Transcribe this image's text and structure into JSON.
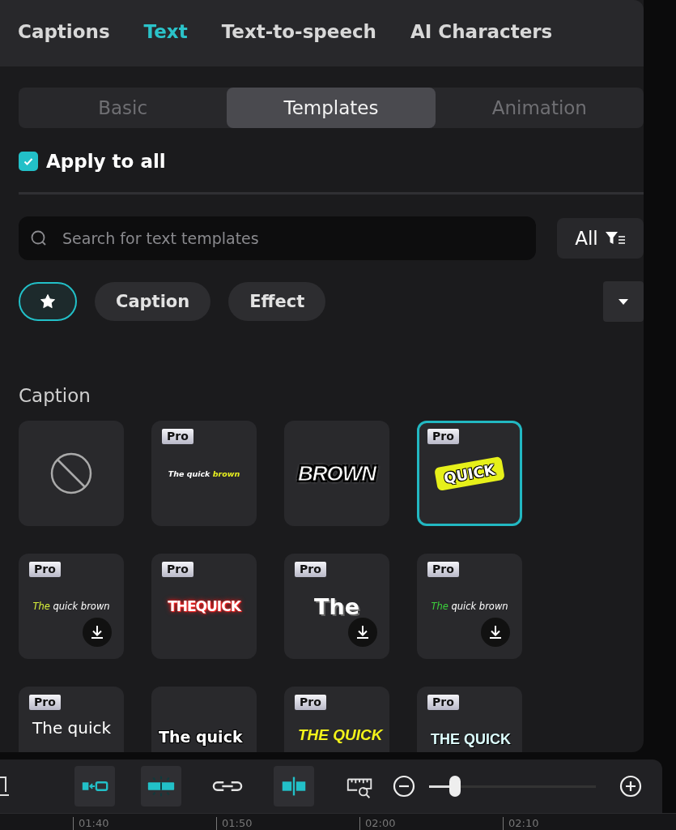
{
  "top_tabs": [
    {
      "label": "Captions",
      "selected": false
    },
    {
      "label": "Text",
      "selected": true
    },
    {
      "label": "Text-to-speech",
      "selected": false
    },
    {
      "label": "AI Characters",
      "selected": false
    }
  ],
  "sub_tabs": [
    {
      "label": "Basic",
      "selected": false
    },
    {
      "label": "Templates",
      "selected": true
    },
    {
      "label": "Animation",
      "selected": false
    }
  ],
  "apply_to_all": {
    "label": "Apply to all",
    "checked": true
  },
  "search": {
    "placeholder": "Search for text templates"
  },
  "filter_button": {
    "label": "All"
  },
  "chips": [
    {
      "kind": "favorites",
      "selected": true
    },
    {
      "kind": "text",
      "label": "Caption",
      "selected": false
    },
    {
      "kind": "text",
      "label": "Effect",
      "selected": false
    }
  ],
  "section_title": "Caption",
  "templates": [
    {
      "kind": "none",
      "selected": false,
      "download": false
    },
    {
      "kind": "accent-end",
      "badge": "Pro",
      "selected": false,
      "download": false,
      "text": "The quick",
      "accent": "brown",
      "color": "#e8f020"
    },
    {
      "kind": "comic",
      "selected": false,
      "download": false,
      "text": "BROWN"
    },
    {
      "kind": "sticker",
      "badge": "Pro",
      "selected": true,
      "download": false,
      "text": "QUICK"
    },
    {
      "kind": "accent-start",
      "badge": "Pro",
      "selected": false,
      "download": true,
      "text": "quick brown",
      "accent": "The",
      "color": "#d8f03a"
    },
    {
      "kind": "glow",
      "badge": "Pro",
      "selected": false,
      "download": false,
      "text": "THEQUICK"
    },
    {
      "kind": "grunge",
      "badge": "Pro",
      "selected": false,
      "download": true,
      "text": "The"
    },
    {
      "kind": "accent-start",
      "badge": "Pro",
      "selected": false,
      "download": true,
      "text": "quick brown",
      "accent": "The",
      "color": "#3ccf3c"
    },
    {
      "kind": "plain-large",
      "badge": "Pro",
      "selected": false,
      "download": false,
      "text": "The quick"
    },
    {
      "kind": "outline",
      "selected": false,
      "download": false,
      "text": "The quick"
    },
    {
      "kind": "italic-yellow",
      "badge": "Pro",
      "selected": false,
      "download": false,
      "text": "THE QUICK"
    },
    {
      "kind": "condensed",
      "badge": "Pro",
      "selected": false,
      "download": false,
      "text": "THE QUICK"
    }
  ],
  "toolbar": {
    "buttons": [
      {
        "kind": "snap",
        "on": true
      },
      {
        "kind": "split",
        "on": true
      },
      {
        "kind": "link",
        "on": false
      },
      {
        "kind": "align",
        "on": true
      },
      {
        "kind": "ruler-zoom",
        "on": false
      }
    ],
    "zoom": {
      "level": 0.12
    }
  },
  "ruler": {
    "labels": [
      "01:40",
      "01:50",
      "02:00",
      "02:10"
    ]
  }
}
